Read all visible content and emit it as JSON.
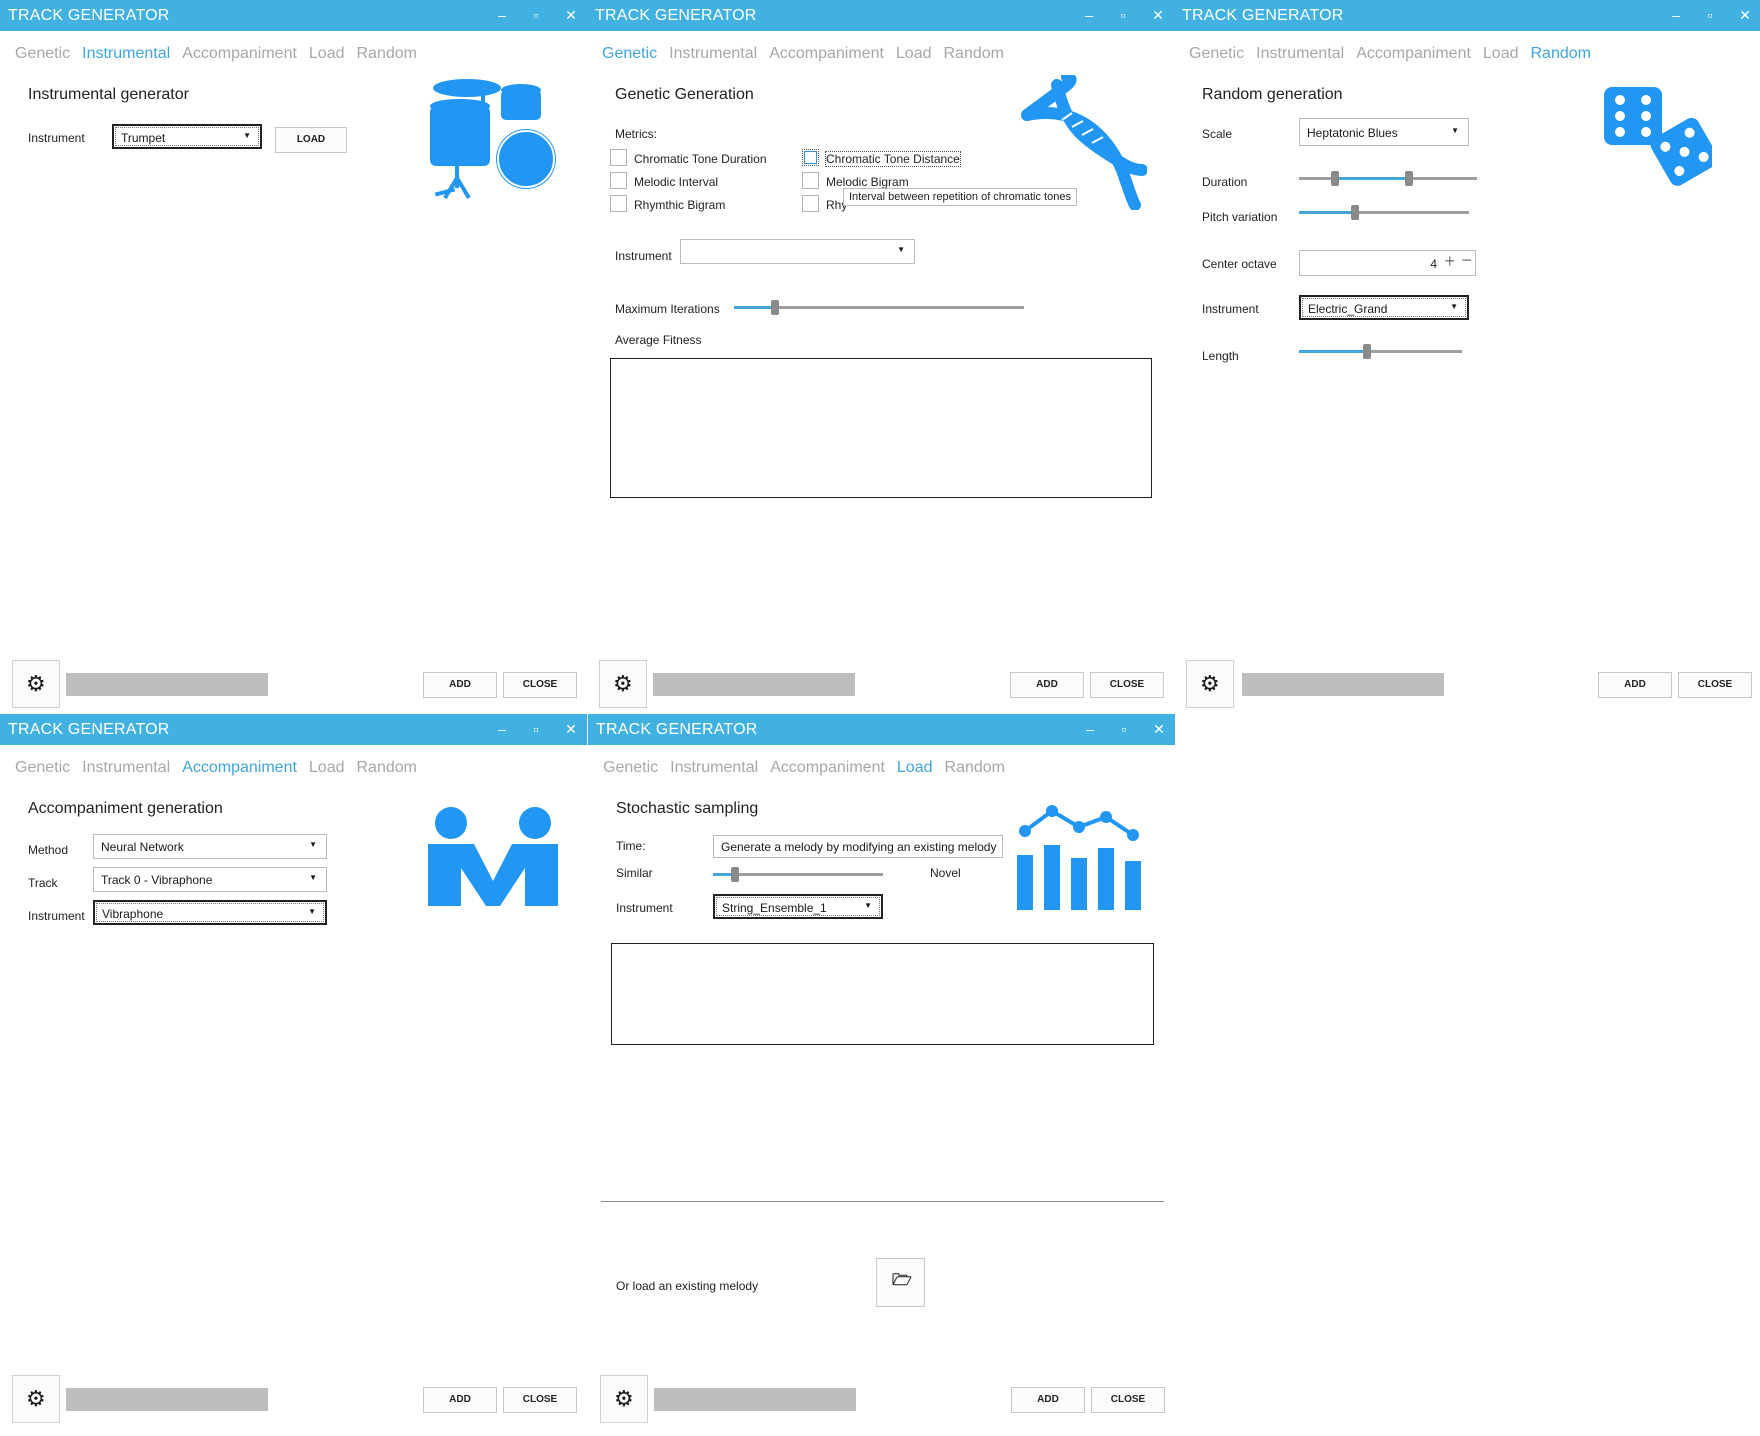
{
  "app_title": "TRACK GENERATOR",
  "tabs": [
    "Genetic",
    "Instrumental",
    "Accompaniment",
    "Load",
    "Random"
  ],
  "footer": {
    "add_label": "ADD",
    "close_label": "CLOSE"
  },
  "window_controls": {
    "minimize": "minimize-icon",
    "maximize": "maximize-icon",
    "close": "close-icon"
  },
  "accent_color": "#41b1e1",
  "icon_color": "#2196f3",
  "instrumental": {
    "active_tab": "Instrumental",
    "heading": "Instrumental generator",
    "instrument_label": "Instrument",
    "instrument_value": "Trumpet",
    "load_label": "LOAD",
    "icon": "drum-kit-icon"
  },
  "genetic": {
    "active_tab": "Genetic",
    "heading": "Genetic Generation",
    "metrics_label": "Metrics:",
    "metrics": [
      "Chromatic Tone Duration",
      "Chromatic Tone Distance",
      "Melodic Interval",
      "Melodic Bigram",
      "Rhymthic Bigram",
      "Rhythmic Interval"
    ],
    "metric_partial": "Rhy",
    "tooltip": "Interval between repetition of chromatic tones",
    "instrument_label": "Instrument",
    "instrument_value": "",
    "iterations_label": "Maximum Iterations",
    "iterations_fraction": 0.14,
    "fitness_label": "Average Fitness",
    "icon": "dna-icon"
  },
  "random": {
    "active_tab": "Random",
    "heading": "Random generation",
    "scale_label": "Scale",
    "scale_value": "Heptatonic Blues",
    "duration_label": "Duration",
    "duration_range": [
      0.2,
      0.62
    ],
    "pitch_label": "Pitch variation",
    "pitch_fraction": 0.33,
    "octave_label": "Center octave",
    "octave_value": "4",
    "instrument_label": "Instrument",
    "instrument_value": "Electric_Grand",
    "length_label": "Length",
    "length_fraction": 0.42,
    "icon": "dice-icon"
  },
  "accompaniment": {
    "active_tab": "Accompaniment",
    "heading": "Accompaniment generation",
    "method_label": "Method",
    "method_value": "Neural Network",
    "track_label": "Track",
    "track_value": "Track 0 - Vibraphone",
    "instrument_label": "Instrument",
    "instrument_value": "Vibraphone",
    "icon": "people-icon"
  },
  "load": {
    "active_tab": "Load",
    "heading": "Stochastic sampling",
    "time_label": "Time:",
    "time_value": "Generate a melody by modifying an existing melody",
    "similar_label": "Similar",
    "novel_label": "Novel",
    "similar_fraction": 0.13,
    "instrument_label": "Instrument",
    "instrument_value": "String_Ensemble_1",
    "or_load_label": "Or load an existing melody",
    "icon": "chart-icon",
    "folder_icon": "folder-open-icon"
  }
}
